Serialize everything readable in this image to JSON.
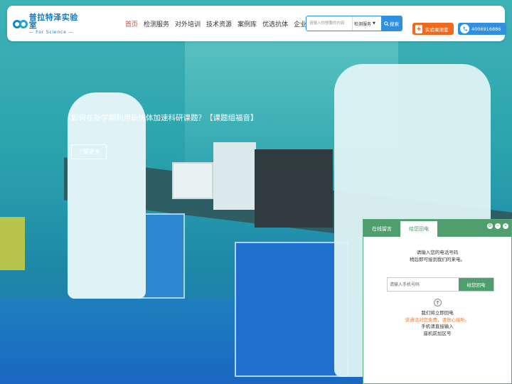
{
  "header": {
    "logo": {
      "name": "普拉特泽实验室",
      "subtitle": "— For Science —"
    },
    "nav": [
      {
        "label": "首页",
        "active": true
      },
      {
        "label": "检测服务",
        "active": false
      },
      {
        "label": "对外培训",
        "active": false
      },
      {
        "label": "技术资源",
        "active": false
      },
      {
        "label": "案例库",
        "active": false
      },
      {
        "label": "优选抗体",
        "active": false
      },
      {
        "label": "企业展示",
        "active": false
      }
    ],
    "search": {
      "placeholder": "请输入你想要的内容",
      "category": "检测服务",
      "button_label": "搜索"
    },
    "lab_mall_label": "实验果须套",
    "phone": "4006916886",
    "colors": {
      "active_nav": "#e83a2f",
      "primary_blue": "#2f8fe0",
      "mall_orange": "#f06a1e"
    }
  },
  "hero": {
    "title": "如何在新学期利用新抗体加速科研课题？【课题组福音】",
    "cta_label": "了解更多"
  },
  "callback_widget": {
    "tabs": [
      {
        "label": "在线留言",
        "active": false
      },
      {
        "label": "给您回电",
        "active": true
      }
    ],
    "window_controls": [
      "settings-icon",
      "minimize-icon",
      "close-icon"
    ],
    "intro_line1": "请输入您的电话号码",
    "intro_line2": "稍后即可接到我们的来电。",
    "phone_placeholder": "请输入手机号码",
    "submit_label": "给您回电",
    "note_1": "我们将立即回电",
    "note_2": "该通话对您免费，请放心接听。",
    "note_3": "手机请直接输入",
    "note_4": "座机前加区号",
    "accent_color": "#4f9f6e"
  }
}
